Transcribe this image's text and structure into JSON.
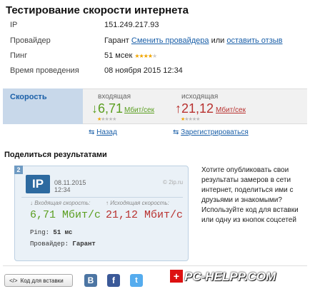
{
  "page": {
    "title": "Тестирование скорости интернета"
  },
  "info": {
    "ip_label": "IP",
    "ip_value": "151.249.217.93",
    "provider_label": "Провайдер",
    "provider_name": "Гарант",
    "change_provider_link": "Сменить провайдера",
    "or_text": "или",
    "review_link": "оставить отзыв",
    "ping_label": "Пинг",
    "ping_value": "51 мсек",
    "ping_rating": 4,
    "time_label": "Время проведения",
    "time_value": "08 ноября 2015 12:34"
  },
  "speed": {
    "tab_label": "Скорость",
    "download_caption": "входящая",
    "download_arrow": "↓",
    "download_value": "6,71",
    "download_unit": "Мбит/сек",
    "upload_caption": "исходящая",
    "upload_arrow": "↑",
    "upload_value": "21,12",
    "upload_unit": "Мбит/сек",
    "download_rating": 1,
    "upload_rating": 1,
    "colors": {
      "download": "#5a9e1f",
      "upload": "#b8312f",
      "link": "#1a5fa8"
    }
  },
  "nav": {
    "back_icon": "⇆",
    "back_label": "Назад",
    "register_icon": "⇆",
    "register_label": "Зарегистрироваться"
  },
  "share": {
    "title": "Поделиться результатами",
    "card": {
      "badge": "2",
      "logo_text": "IP",
      "date": "08.11.2015",
      "time": "12:34",
      "site": "© 2ip.ru",
      "download_caption": "↓ Входящая скорость:",
      "upload_caption": "↑ Исходящая скорость:",
      "download_value": "6,71 Мбит/с",
      "upload_value": "21,12 Мбит/с",
      "ping_label": "Ping:",
      "ping_value": "51 мс",
      "provider_label": "Провайдер:",
      "provider_value": "Гарант"
    },
    "description": "Хотите опубликовать свои результаты замеров в сети интернет, поделиться ими с друзьями и знакомыми? Используйте код для вставки или одну из кнопок соцсетей"
  },
  "footer": {
    "code_button_icon": "</>",
    "code_button_label": "Код для вставки",
    "vk": "B",
    "facebook": "f",
    "twitter": "t",
    "brand_plus": "+",
    "brand_text": "PC-HELPP.COM"
  }
}
